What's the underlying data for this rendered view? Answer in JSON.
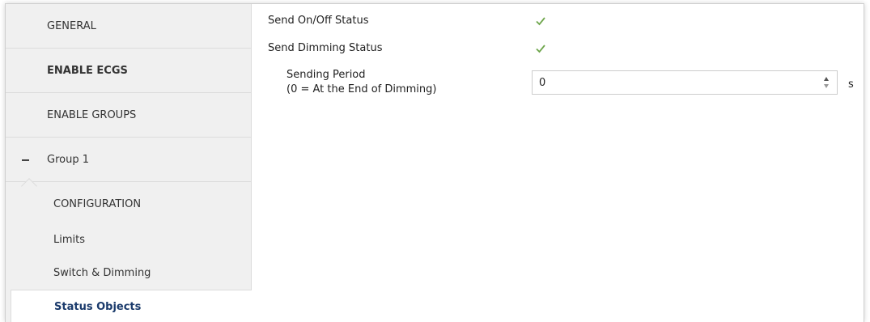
{
  "sidebar": {
    "items": [
      {
        "label": "GENERAL"
      },
      {
        "label": "ENABLE ECGS"
      },
      {
        "label": "ENABLE GROUPS"
      },
      {
        "label": "Group 1"
      },
      {
        "label": "CONFIGURATION"
      },
      {
        "label": "Limits"
      },
      {
        "label": "Switch & Dimming"
      },
      {
        "label": "Status Objects"
      }
    ]
  },
  "main": {
    "send_onoff": {
      "label": "Send On/Off Status",
      "checked": true
    },
    "send_dimming": {
      "label": "Send Dimming Status",
      "checked": true
    },
    "sending_period": {
      "label_line1": "Sending Period",
      "label_line2": "(0 = At the End of Dimming)",
      "value": "0",
      "unit": "s"
    }
  },
  "icons": {
    "check": "check-icon",
    "collapse": "minus-icon",
    "spin_up": "arrow-up-icon",
    "spin_down": "arrow-down-icon"
  },
  "colors": {
    "check": "#6fa64d",
    "active_text": "#1a3a6b",
    "sidebar_bg": "#f0f0f0"
  }
}
